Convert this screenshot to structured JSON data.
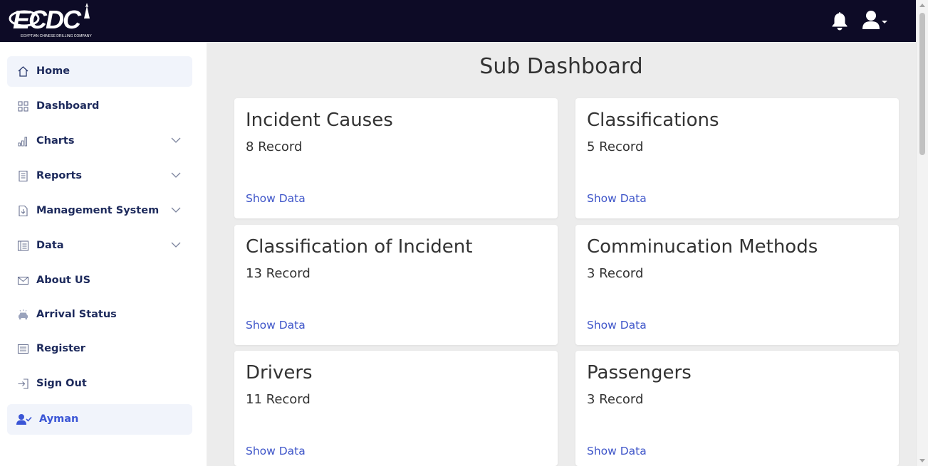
{
  "header": {
    "logo_text": "ECDC",
    "logo_subtitle": "EGYPTIAN CHINESE DRILLING COMPANY",
    "icons": [
      "bell-icon",
      "user-icon",
      "caret-down-icon"
    ]
  },
  "sidebar": {
    "items": [
      {
        "label": "Home",
        "icon": "home-icon",
        "has_submenu": false
      },
      {
        "label": "Dashboard",
        "icon": "grid-icon",
        "has_submenu": false
      },
      {
        "label": "Charts",
        "icon": "bar-chart-icon",
        "has_submenu": true
      },
      {
        "label": "Reports",
        "icon": "report-icon",
        "has_submenu": true
      },
      {
        "label": "Management System",
        "icon": "download-doc-icon",
        "has_submenu": true
      },
      {
        "label": "Data",
        "icon": "table-icon",
        "has_submenu": true
      },
      {
        "label": "About US",
        "icon": "envelope-icon",
        "has_submenu": false
      },
      {
        "label": "Arrival Status",
        "icon": "car-icon",
        "has_submenu": false
      },
      {
        "label": "Register",
        "icon": "list-icon",
        "has_submenu": false
      },
      {
        "label": "Sign Out",
        "icon": "sign-out-icon",
        "has_submenu": false
      }
    ],
    "user": {
      "label": "Ayman",
      "icon": "user-check-icon"
    }
  },
  "main": {
    "title": "Sub Dashboard",
    "cards": [
      {
        "title": "Incident Causes",
        "count": "8 Record",
        "link": "Show Data"
      },
      {
        "title": "Classifications",
        "count": "5 Record",
        "link": "Show Data"
      },
      {
        "title": "Classification of Incident",
        "count": "13 Record",
        "link": "Show Data"
      },
      {
        "title": "Comminucation Methods",
        "count": "3 Record",
        "link": "Show Data"
      },
      {
        "title": "Drivers",
        "count": "11 Record",
        "link": "Show Data"
      },
      {
        "title": "Passengers",
        "count": "3 Record",
        "link": "Show Data"
      }
    ]
  },
  "colors": {
    "topbar": "#0d0b26",
    "accent": "#3e55c9",
    "nav_text": "#1d2a5c",
    "background": "#ececec"
  }
}
